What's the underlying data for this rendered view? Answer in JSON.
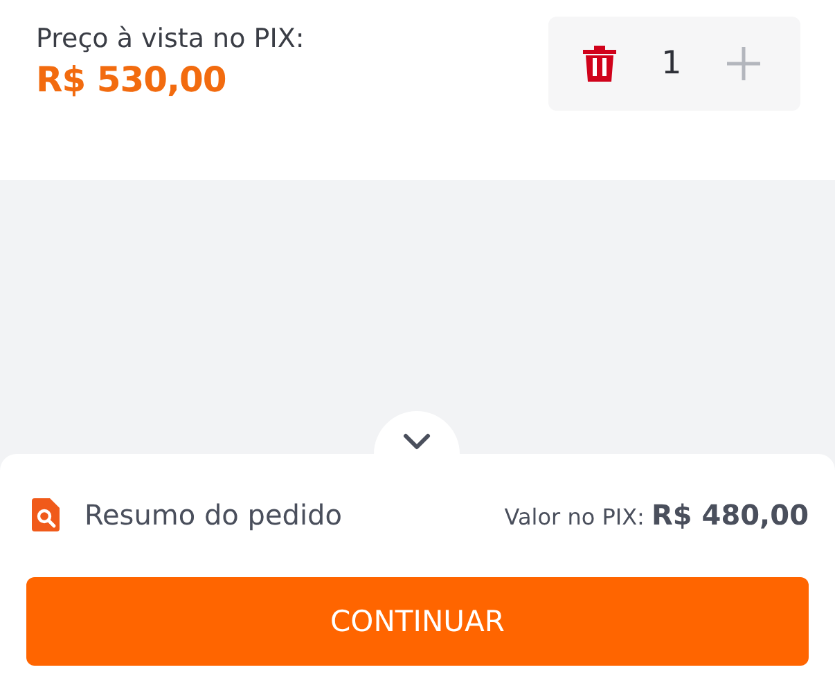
{
  "price": {
    "label": "Preço à vista no PIX:",
    "amount": "R$ 530,00"
  },
  "quantity": {
    "value": "1",
    "plus_disabled": true
  },
  "summary": {
    "title": "Resumo do pedido",
    "total": "Valor no PIX: **R$ 480,00**"
  },
  "button": {
    "label": "CONTINUAR"
  }
}
